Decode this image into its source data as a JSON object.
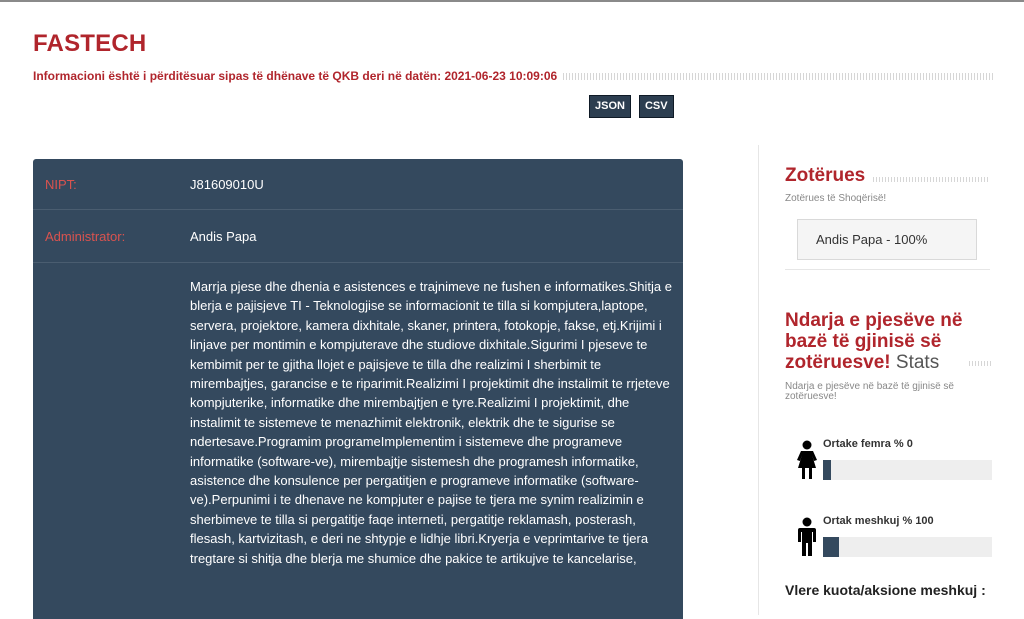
{
  "company": {
    "name": "FASTECH",
    "updated_text": "Informacioni është i përditësuar sipas të dhënave të QKB deri në datën: 2021-06-23 10:09:06"
  },
  "export": {
    "json_label": "JSON",
    "csv_label": "CSV"
  },
  "info": {
    "nipt_label": "NIPT:",
    "nipt_value": "J81609010U",
    "admin_label": "Administrator:",
    "admin_value": "Andis Papa",
    "activity_text": "Marrja pjese dhe dhenia e asistences e trajnimeve ne fushen e informatikes.Shitja e blerja e pajisjeve TI - Teknologjise se informacionit te tilla si kompjutera,laptope, servera, projektore, kamera dixhitale, skaner, printera, fotokopje, fakse, etj.Krijimi i linjave per montimin e kompjuterave dhe studiove dixhitale.Sigurimi I pjeseve te kembimit per te gjitha llojet e pajisjeve te tilla dhe realizimi I sherbimit te mirembajtjes, garancise e te riparimit.Realizimi I projektimit dhe instalimit te rrjeteve kompjuterike, informatike dhe mirembajtjen e tyre.Realizimi I projektimit, dhe instalimit te sistemeve te menazhimit elektronik, elektrik dhe te sigurise se ndertesave.Programim programeImplementim i sistemeve dhe programeve informatike (software-ve), mirembajtje sistemesh dhe programesh informatike, asistence dhe konsulence per pergatitjen e programeve informatike (software-ve).Perpunimi i te dhenave ne kompjuter e pajise te tjera me synim realizimin e sherbimeve te tilla si pergatitje faqe interneti, pergatitje reklamash, posterash, flesash, kartvizitash, e deri ne shtypje e lidhje libri.Kryerja e veprimtarive te tjera tregtare si shitja dhe blerja me shumice dhe pakice te artikujve te kancelarise,"
  },
  "sidebar": {
    "owners_heading": "Zotërues",
    "owners_sub": "Zotërues të Shoqërisë!",
    "owner_item": "Andis Papa - 100%",
    "gender_heading": "Ndarja e pjesëve në bazë të gjinisë së zotëruesve!",
    "stats_word": "Stats",
    "gender_sub": "Ndarja e pjesëve në bazë të gjinisë së zotëruesve!",
    "female_label": "Ortake femra % 0",
    "female_percent": 0,
    "male_label": "Ortak meshkuj % 100",
    "male_percent": 100,
    "quota_heading": "Vlere kuota/aksione meshkuj :"
  },
  "colors": {
    "accent": "#b0252c",
    "panel": "#34495e",
    "label": "#d9534f"
  }
}
